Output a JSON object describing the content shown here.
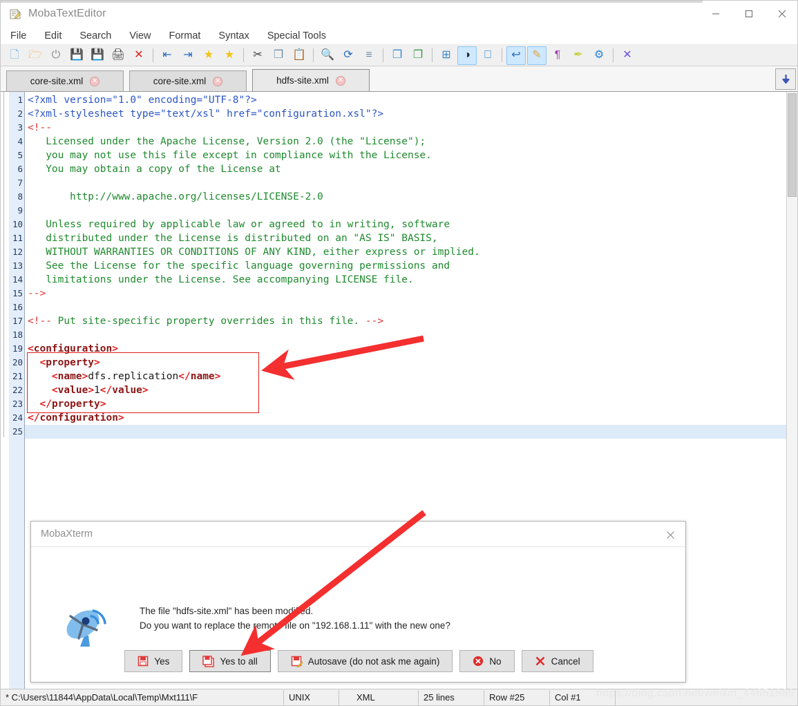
{
  "window": {
    "title": "MobaTextEditor",
    "icon": "notepad-icon",
    "minimize_label": "—",
    "maximize_label": "□",
    "close_label": "✕"
  },
  "menu": {
    "items": [
      {
        "label": "File"
      },
      {
        "label": "Edit"
      },
      {
        "label": "Search"
      },
      {
        "label": "View"
      },
      {
        "label": "Format"
      },
      {
        "label": "Syntax"
      },
      {
        "label": "Special Tools"
      }
    ]
  },
  "toolbar": {
    "buttons": [
      {
        "name": "new-file-icon",
        "glyph": "🗋",
        "color": "#6cb6e8",
        "active": false
      },
      {
        "name": "open-folder-icon",
        "glyph": "🗁",
        "color": "#f0ab32",
        "active": false
      },
      {
        "name": "reload-icon",
        "glyph": "⏻",
        "color": "#8c8c8c",
        "active": false
      },
      {
        "name": "save-icon",
        "glyph": "💾",
        "color": "#555555",
        "active": false
      },
      {
        "name": "save-all-icon",
        "glyph": "💾",
        "color": "#555555",
        "active": false
      },
      {
        "name": "print-icon",
        "glyph": "🖨",
        "color": "#444444",
        "active": false
      },
      {
        "name": "close-file-icon",
        "glyph": "✕",
        "color": "#e02020",
        "active": false
      },
      {
        "name": "separator",
        "glyph": "",
        "color": "",
        "active": false
      },
      {
        "name": "outdent-icon",
        "glyph": "⇤",
        "color": "#2a6bbf",
        "active": false
      },
      {
        "name": "indent-icon",
        "glyph": "⇥",
        "color": "#2a6bbf",
        "active": false
      },
      {
        "name": "bookmark-icon",
        "glyph": "★",
        "color": "#f0c419",
        "active": false
      },
      {
        "name": "bookmark-next-icon",
        "glyph": "★",
        "color": "#f0c419",
        "active": false
      },
      {
        "name": "separator",
        "glyph": "",
        "color": "",
        "active": false
      },
      {
        "name": "cut-icon",
        "glyph": "✂",
        "color": "#3c3c3c",
        "active": false
      },
      {
        "name": "copy-icon",
        "glyph": "❐",
        "color": "#6d8ea8",
        "active": false
      },
      {
        "name": "paste-icon",
        "glyph": "📋",
        "color": "#6d8ea8",
        "active": false
      },
      {
        "name": "separator",
        "glyph": "",
        "color": "",
        "active": false
      },
      {
        "name": "find-icon",
        "glyph": "🔍",
        "color": "#2a6bbf",
        "active": false
      },
      {
        "name": "replace-icon",
        "glyph": "⟳",
        "color": "#2a6bbf",
        "active": false
      },
      {
        "name": "goto-line-icon",
        "glyph": "≡",
        "color": "#6d8ea8",
        "active": false
      },
      {
        "name": "separator",
        "glyph": "",
        "color": "",
        "active": false
      },
      {
        "name": "send-to-icon",
        "glyph": "❐",
        "color": "#3a86d0",
        "active": false
      },
      {
        "name": "receive-from-icon",
        "glyph": "❐",
        "color": "#3a9a4a",
        "active": false
      },
      {
        "name": "separator",
        "glyph": "",
        "color": "",
        "active": false
      },
      {
        "name": "windows-format-icon",
        "glyph": "⊞",
        "color": "#3a86d0",
        "active": false
      },
      {
        "name": "unix-format-icon",
        "glyph": "◑",
        "color": "#2a2a2a",
        "active": true
      },
      {
        "name": "mac-format-icon",
        "glyph": "",
        "color": "#2a86d8",
        "active": false
      },
      {
        "name": "separator",
        "glyph": "",
        "color": "",
        "active": false
      },
      {
        "name": "undo-icon",
        "glyph": "↩",
        "color": "#2a6bbf",
        "active": true
      },
      {
        "name": "edit-mode-icon",
        "glyph": "✎",
        "color": "#e8a33d",
        "active": true
      },
      {
        "name": "pilcrow-icon",
        "glyph": "¶",
        "color": "#9b3fa8",
        "active": false
      },
      {
        "name": "highlighter-icon",
        "glyph": "✒",
        "color": "#c8d13a",
        "active": false
      },
      {
        "name": "settings-icon",
        "glyph": "⚙",
        "color": "#2a86d8",
        "active": false
      },
      {
        "name": "separator",
        "glyph": "",
        "color": "",
        "active": false
      },
      {
        "name": "exit-icon",
        "glyph": "✕",
        "color": "#6b4fd8",
        "active": false
      }
    ]
  },
  "tabs": {
    "items": [
      {
        "label": "core-site.xml",
        "active": false
      },
      {
        "label": "core-site.xml",
        "active": false
      },
      {
        "label": "hdfs-site.xml",
        "active": true
      }
    ],
    "close_glyph": "✕",
    "scroll_glyph": "⬇"
  },
  "editor": {
    "total_lines": 25,
    "current_line": 25,
    "lines": [
      {
        "n": 1,
        "tokens": [
          {
            "t": "<?xml version=\"1.0\" encoding=\"UTF-8\"?>",
            "c": "c-blue"
          }
        ]
      },
      {
        "n": 2,
        "tokens": [
          {
            "t": "<?xml-stylesheet type=\"text/xsl\" href=\"configuration.xsl\"?>",
            "c": "c-blue"
          }
        ]
      },
      {
        "n": 3,
        "tokens": [
          {
            "t": "<!--",
            "c": "c-red"
          }
        ]
      },
      {
        "n": 4,
        "tokens": [
          {
            "t": "   Licensed under the Apache License, Version 2.0 (the \"License\");",
            "c": "c-green"
          }
        ]
      },
      {
        "n": 5,
        "tokens": [
          {
            "t": "   you may not use this file except in compliance with the License.",
            "c": "c-green"
          }
        ]
      },
      {
        "n": 6,
        "tokens": [
          {
            "t": "   You may obtain a copy of the License at",
            "c": "c-green"
          }
        ]
      },
      {
        "n": 7,
        "tokens": [
          {
            "t": "",
            "c": "c-green"
          }
        ]
      },
      {
        "n": 8,
        "tokens": [
          {
            "t": "       http://www.apache.org/licenses/LICENSE-2.0",
            "c": "c-green"
          }
        ]
      },
      {
        "n": 9,
        "tokens": [
          {
            "t": "",
            "c": "c-green"
          }
        ]
      },
      {
        "n": 10,
        "tokens": [
          {
            "t": "   Unless required by applicable law or agreed to in writing, software",
            "c": "c-green"
          }
        ]
      },
      {
        "n": 11,
        "tokens": [
          {
            "t": "   distributed under the License is distributed on an \"AS IS\" BASIS,",
            "c": "c-green"
          }
        ]
      },
      {
        "n": 12,
        "tokens": [
          {
            "t": "   WITHOUT WARRANTIES OR CONDITIONS OF ANY KIND, either express or implied.",
            "c": "c-green"
          }
        ]
      },
      {
        "n": 13,
        "tokens": [
          {
            "t": "   See the License for the specific language governing permissions and",
            "c": "c-green"
          }
        ]
      },
      {
        "n": 14,
        "tokens": [
          {
            "t": "   limitations under the License. See accompanying LICENSE file.",
            "c": "c-green"
          }
        ]
      },
      {
        "n": 15,
        "tokens": [
          {
            "t": "-->",
            "c": "c-red"
          }
        ]
      },
      {
        "n": 16,
        "tokens": [
          {
            "t": "",
            "c": "c-green"
          }
        ]
      },
      {
        "n": 17,
        "tokens": [
          {
            "t": "<!--",
            "c": "c-red"
          },
          {
            "t": " Put site-specific property overrides in this file. ",
            "c": "c-green"
          },
          {
            "t": "-->",
            "c": "c-red"
          }
        ]
      },
      {
        "n": 18,
        "tokens": [
          {
            "t": "",
            "c": "c-green"
          }
        ]
      },
      {
        "n": 19,
        "tokens": [
          {
            "t": "<",
            "c": "c-brkt"
          },
          {
            "t": "configuration",
            "c": "c-tag"
          },
          {
            "t": ">",
            "c": "c-brkt"
          }
        ]
      },
      {
        "n": 20,
        "tokens": [
          {
            "t": "  ",
            "c": "c-txt"
          },
          {
            "t": "<",
            "c": "c-brkt"
          },
          {
            "t": "property",
            "c": "c-tag"
          },
          {
            "t": ">",
            "c": "c-brkt"
          }
        ]
      },
      {
        "n": 21,
        "tokens": [
          {
            "t": "    ",
            "c": "c-txt"
          },
          {
            "t": "<",
            "c": "c-brkt"
          },
          {
            "t": "name",
            "c": "c-tag"
          },
          {
            "t": ">",
            "c": "c-brkt"
          },
          {
            "t": "dfs.replication",
            "c": "c-txt"
          },
          {
            "t": "</",
            "c": "c-brkt"
          },
          {
            "t": "name",
            "c": "c-tag"
          },
          {
            "t": ">",
            "c": "c-brkt"
          }
        ]
      },
      {
        "n": 22,
        "tokens": [
          {
            "t": "    ",
            "c": "c-txt"
          },
          {
            "t": "<",
            "c": "c-brkt"
          },
          {
            "t": "value",
            "c": "c-tag"
          },
          {
            "t": ">",
            "c": "c-brkt"
          },
          {
            "t": "1",
            "c": "c-txt"
          },
          {
            "t": "</",
            "c": "c-brkt"
          },
          {
            "t": "value",
            "c": "c-tag"
          },
          {
            "t": ">",
            "c": "c-brkt"
          }
        ]
      },
      {
        "n": 23,
        "tokens": [
          {
            "t": "  ",
            "c": "c-txt"
          },
          {
            "t": "</",
            "c": "c-brkt"
          },
          {
            "t": "property",
            "c": "c-tag"
          },
          {
            "t": ">",
            "c": "c-brkt"
          }
        ]
      },
      {
        "n": 24,
        "tokens": [
          {
            "t": "</",
            "c": "c-brkt"
          },
          {
            "t": "configuration",
            "c": "c-tag"
          },
          {
            "t": ">",
            "c": "c-brkt"
          }
        ]
      },
      {
        "n": 25,
        "tokens": [
          {
            "t": "",
            "c": "c-txt"
          }
        ]
      }
    ]
  },
  "annotations": {
    "box_color": "#e01f1f",
    "arrow_color": "#f42f2f",
    "arrow_top_label": "arrow-pointing-to-property-block",
    "arrow_bottom_label": "arrow-pointing-to-yes-to-all"
  },
  "dialog": {
    "title": "MobaXterm",
    "close_glyph": "✕",
    "icon": "satellite-dish-icon",
    "message_line1": "The file \"hdfs-site.xml\" has been modified.",
    "message_line2": "Do you want to replace the remote file on \"192.168.1.11\" with the new one?",
    "buttons": [
      {
        "label": "Yes",
        "icon": "save-icon",
        "focused": false
      },
      {
        "label": "Yes to all",
        "icon": "save-all-icon",
        "focused": true
      },
      {
        "label": "Autosave (do not ask me again)",
        "icon": "autosave-icon",
        "focused": false
      },
      {
        "label": "No",
        "icon": "cancel-circle-icon",
        "focused": false
      },
      {
        "label": "Cancel",
        "icon": "x-icon",
        "focused": false
      }
    ]
  },
  "statusbar": {
    "path": "* C:\\Users\\11844\\AppData\\Local\\Temp\\Mxt111\\F",
    "encoding": "UNIX",
    "syntax": "XML",
    "lines": "25 lines",
    "row": "Row #25",
    "col": "Col #1",
    "watermark": "https://blog.csdn.net/weixin_44651989"
  }
}
